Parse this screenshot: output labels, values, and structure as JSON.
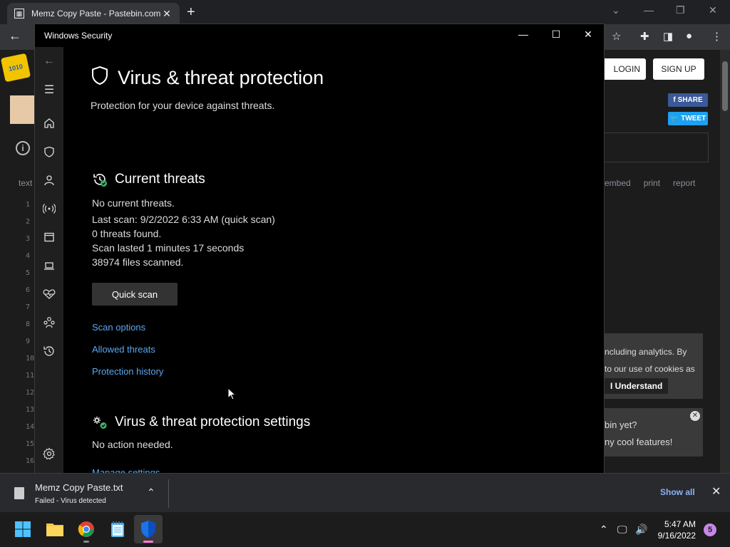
{
  "chrome": {
    "tab_title": "Memz Copy Paste - Pastebin.com",
    "tab_close": "✕",
    "new_tab": "+"
  },
  "pastebin": {
    "login": "LOGIN",
    "signup": "SIGN UP",
    "share": "SHARE",
    "tweet": "TWEET",
    "links": [
      "embed",
      "print",
      "report"
    ],
    "text_label": "text",
    "cookie_line1": "ncluding analytics. By",
    "cookie_line2": "to our use of cookies as",
    "understand": "I Understand",
    "promo_line1": "bin yet?",
    "promo_line2": "ny cool features!",
    "line_numbers": [
      "1",
      "2",
      "3",
      "4",
      "5",
      "6",
      "7",
      "8",
      "9",
      "10",
      "11",
      "12",
      "13",
      "14",
      "15",
      "16"
    ]
  },
  "window": {
    "title": "Windows Security"
  },
  "main": {
    "heading": "Virus & threat protection",
    "subtitle": "Protection for your device against threats.",
    "current_threats": {
      "heading": "Current threats",
      "no_threats": "No current threats.",
      "last_scan": "Last scan: 9/2/2022 6:33 AM (quick scan)",
      "threats_found": "0 threats found.",
      "scan_duration": "Scan lasted 1 minutes 17 seconds",
      "files_scanned": "38974 files scanned.",
      "quick_scan_button": "Quick scan"
    },
    "links": {
      "scan_options": "Scan options",
      "allowed_threats": "Allowed threats",
      "protection_history": "Protection history"
    },
    "settings": {
      "heading": "Virus & threat protection settings",
      "status": "No action needed.",
      "manage": "Manage settings"
    }
  },
  "download": {
    "file_name": "Memz Copy Paste.txt",
    "status": "Failed - Virus detected",
    "show_all": "Show all"
  },
  "taskbar": {
    "time": "5:47 AM",
    "date": "9/16/2022",
    "notifications": "5"
  },
  "colors": {
    "accent_link": "#5aa7f0",
    "window_bg": "#000000",
    "nav_bg": "#1f1f1f",
    "check_green": "#3cb371"
  }
}
